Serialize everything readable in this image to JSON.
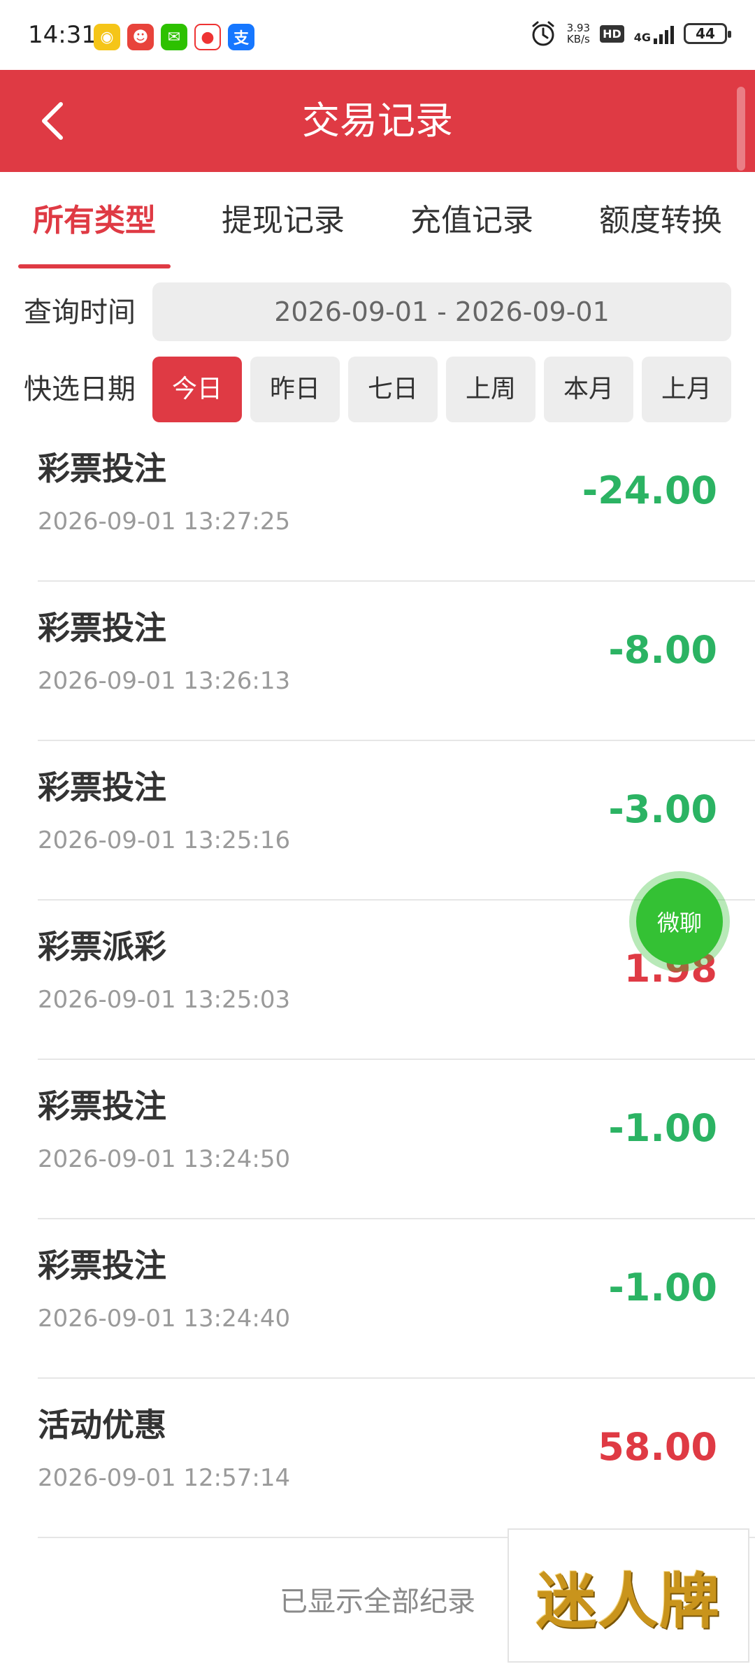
{
  "status_bar": {
    "time": "14:31",
    "net_speed_value": "3.93",
    "net_speed_unit": "KB/s",
    "hd": "HD",
    "network": "4G",
    "battery": "44",
    "app_icons": [
      "weibo-icon",
      "app-red-icon",
      "wechat-icon",
      "video-icon",
      "alipay-icon"
    ]
  },
  "header": {
    "title": "交易记录",
    "back_icon": "chevron-left-icon",
    "color": "#df3a44"
  },
  "tabs": [
    {
      "label": "所有类型",
      "active": true
    },
    {
      "label": "提现记录",
      "active": false
    },
    {
      "label": "充值记录",
      "active": false
    },
    {
      "label": "额度转换",
      "active": false
    }
  ],
  "query": {
    "label": "查询时间",
    "range": "2026-09-01 - 2026-09-01"
  },
  "quick": {
    "label": "快选日期",
    "options": [
      {
        "label": "今日",
        "active": true
      },
      {
        "label": "昨日",
        "active": false
      },
      {
        "label": "七日",
        "active": false
      },
      {
        "label": "上周",
        "active": false
      },
      {
        "label": "本月",
        "active": false
      },
      {
        "label": "上月",
        "active": false
      }
    ]
  },
  "records": [
    {
      "title": "彩票投注",
      "time": "2026-09-01 13:27:25",
      "amount": "-24.00",
      "type": "neg"
    },
    {
      "title": "彩票投注",
      "time": "2026-09-01 13:26:13",
      "amount": "-8.00",
      "type": "neg"
    },
    {
      "title": "彩票投注",
      "time": "2026-09-01 13:25:16",
      "amount": "-3.00",
      "type": "neg"
    },
    {
      "title": "彩票派彩",
      "time": "2026-09-01 13:25:03",
      "amount": "1.98",
      "type": "pos"
    },
    {
      "title": "彩票投注",
      "time": "2026-09-01 13:24:50",
      "amount": "-1.00",
      "type": "neg"
    },
    {
      "title": "彩票投注",
      "time": "2026-09-01 13:24:40",
      "amount": "-1.00",
      "type": "neg"
    },
    {
      "title": "活动优惠",
      "time": "2026-09-01 12:57:14",
      "amount": "58.00",
      "type": "pos"
    }
  ],
  "colors": {
    "negative": "#2bb363",
    "positive": "#df3a44"
  },
  "footer": {
    "text": "已显示全部纪录"
  },
  "float_chat": {
    "label": "微聊"
  },
  "logo": {
    "text": "迷人牌"
  }
}
